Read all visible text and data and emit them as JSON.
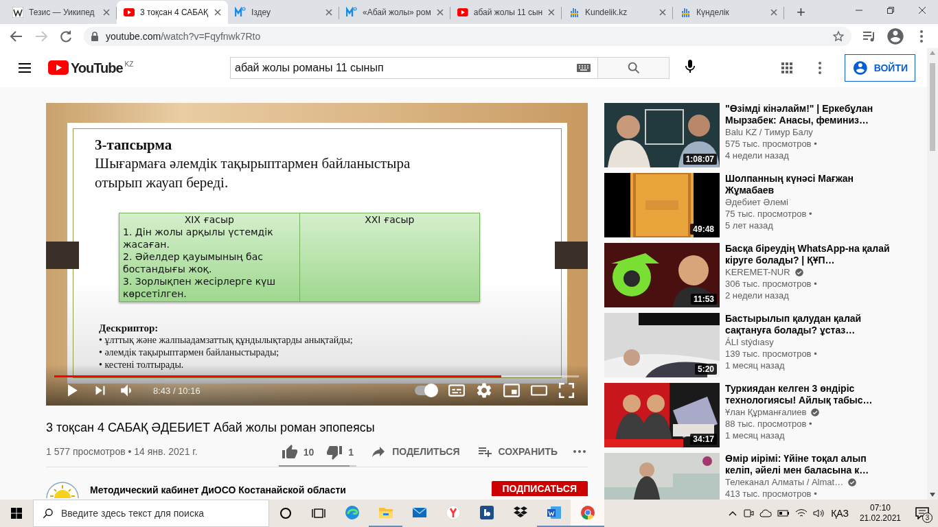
{
  "browser": {
    "tabs": [
      {
        "title": "Тезис — Уикипед",
        "kind": "wiki",
        "selected": false
      },
      {
        "title": "3 тоқсан 4 САБАҚ",
        "kind": "youtube",
        "selected": true
      },
      {
        "title": "Іздеу",
        "kind": "mail",
        "selected": false
      },
      {
        "title": "«Абай жолы» ром",
        "kind": "mail",
        "selected": false
      },
      {
        "title": "абай жолы 11 сын",
        "kind": "youtube",
        "selected": false
      },
      {
        "title": "Kundelik.kz",
        "kind": "kundelik",
        "selected": false
      },
      {
        "title": "Күнделік",
        "kind": "kundelik",
        "selected": false
      }
    ],
    "new_tab": "+",
    "url": {
      "host": "youtube.com",
      "path": "/watch?v=Fqyfnwk7Rto"
    }
  },
  "youtube": {
    "logo": "YouTube",
    "region": "KZ",
    "search": "абай жолы романы 11 сынып",
    "signin": "ВОЙТИ"
  },
  "slide": {
    "heading": "3-тапсырма",
    "task": "Шығармаға әлемдік тақырыптармен байланыстыра отырып жауап береді.",
    "columns": [
      {
        "header": "XIX ғасыр",
        "lines": [
          "1. Дін жолы арқылы үстемдік жасаған.",
          "2. Әйелдер қауымының бас бостандығы жоқ.",
          "3. Зорлықпен жесірлерге күш көрсетілген."
        ]
      },
      {
        "header": "XXI ғасыр"
      }
    ],
    "descriptor": {
      "title": "Дескриптор:",
      "items": [
        "• ұлттық және жалпыадамзаттық құндылықтарды анықтайды;",
        "• әлемдік тақырыптармен байланыстырады;",
        "• кестені толтырады."
      ]
    }
  },
  "player": {
    "progress": {
      "level": 0.852
    },
    "time": "8:43 / 10:16",
    "autoplay": {
      "on": true
    }
  },
  "video": {
    "title": "3 тоқсан 4 САБАҚ ӘДЕБИЕТ Абай жолы роман эпопеясы",
    "stats": "1 577 просмотров • 14 янв. 2021 г.",
    "likes": "10",
    "dislikes": "1",
    "sentiment": {
      "level": 0.91
    },
    "actions": [
      {
        "kind": "share",
        "label": "ПОДЕЛИТЬСЯ"
      },
      {
        "kind": "save",
        "label": "СОХРАНИТЬ"
      }
    ],
    "channel": "Методический кабинет ДиОСО Костанайской области",
    "subscribe": "ПОДПИСАТЬСЯ"
  },
  "related": [
    {
      "title": "\"Өзімді кінәлайм!\" | Еркебұлан Мырзабек: Анасы, феминиз…",
      "channel": "Balu KZ / Тимур Балу",
      "verified": false,
      "views": "575 тыс. просмотров •",
      "age": "4 недели назад",
      "duration": "1:08:07"
    },
    {
      "title": "Шолпанның күнәсі Мағжан Жұмабаев",
      "channel": "Әдебиет Әлемі",
      "verified": false,
      "views": "75 тыс. просмотров •",
      "age": "5 лет назад",
      "duration": "49:48"
    },
    {
      "title": "Басқа біреудің WhatsApp-на қалай кіруге болады? | ҚҰП…",
      "channel": "KEREMET-NUR",
      "verified": true,
      "views": "306 тыс. просмотров •",
      "age": "2 недели назад",
      "duration": "11:53"
    },
    {
      "title": "Бастырылып қалудан қалай сақтануға болады? ұстаз…",
      "channel": "ÁLI stýdıasy",
      "verified": false,
      "views": "139 тыс. просмотров •",
      "age": "1 месяц назад",
      "duration": "5:20"
    },
    {
      "title": "Туркиядан келген 3 өндіріс технологиясы! Айлық табыс…",
      "channel": "Ұлан Құрманғалиев",
      "verified": true,
      "views": "88 тыс. просмотров •",
      "age": "1 месяц назад",
      "duration": "34:17"
    },
    {
      "title": "Өмір иірімі: Үйіне тоқал алып келіп, әйелі мен баласына к…",
      "channel": "Телеканал Алматы / Almat…",
      "verified": true,
      "views": "413 тыс. просмотров •"
    }
  ],
  "taskbar": {
    "search": {
      "placeholder": "Введите здесь текст для поиска"
    },
    "apps": [
      {
        "kind": "edge",
        "running": false,
        "selected": false
      },
      {
        "kind": "explorer",
        "running": true,
        "selected": false
      },
      {
        "kind": "mail",
        "running": false,
        "selected": false
      },
      {
        "kind": "yandex",
        "running": false,
        "selected": false
      },
      {
        "kind": "tile",
        "running": false,
        "selected": false
      },
      {
        "kind": "dropbox",
        "running": false,
        "selected": false
      },
      {
        "kind": "word",
        "running": true,
        "selected": false
      },
      {
        "kind": "chrome",
        "running": true,
        "selected": true
      }
    ],
    "language": "ҚАЗ",
    "time": "07:10",
    "date": "21.02.2021",
    "notifications": "3"
  }
}
